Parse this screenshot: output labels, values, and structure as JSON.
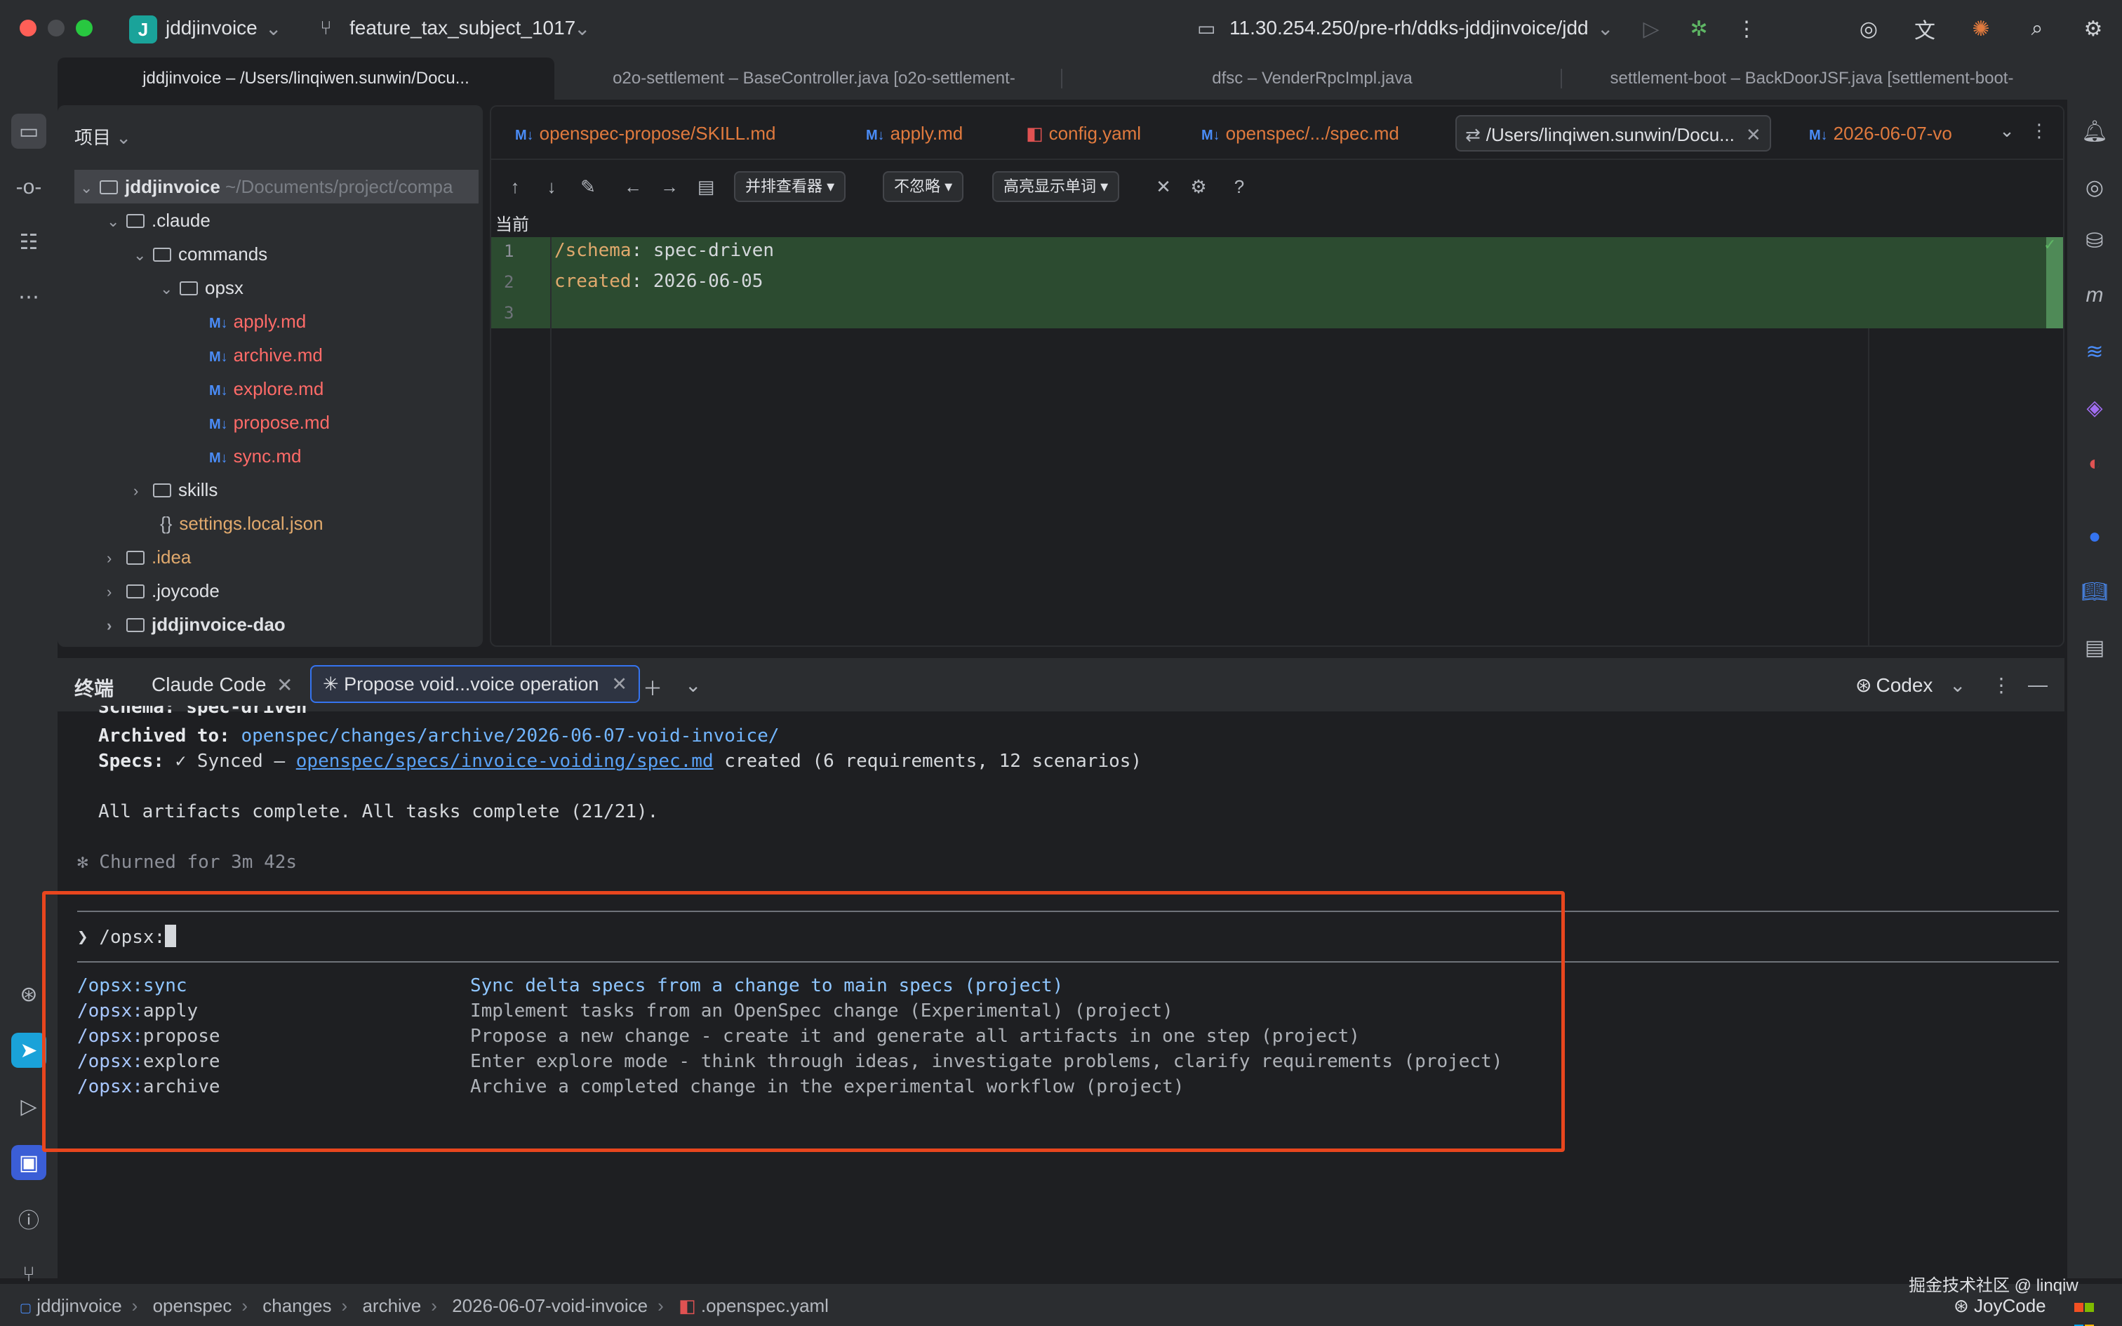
{
  "titlebar": {
    "project_name": "jddjinvoice",
    "project_initial": "J",
    "branch": "feature_tax_subject_1017",
    "remote": "11.30.254.250/pre-rh/ddks-jddjinvoice/jdd"
  },
  "window_tabs": [
    {
      "label": "jddjinvoice – /Users/linqiwen.sunwin/Docu...",
      "active": true
    },
    {
      "label": "o2o-settlement – BaseController.java [o2o-settlement-"
    },
    {
      "label": "dfsc – VenderRpcImpl.java"
    },
    {
      "label": "settlement-boot – BackDoorJSF.java [settlement-boot-"
    }
  ],
  "project_panel": {
    "title": "项目",
    "root_name": "jddjinvoice",
    "root_path": "~/Documents/project/compa",
    "tree": [
      {
        "label": ".claude"
      },
      {
        "label": "commands"
      },
      {
        "label": "opsx"
      },
      {
        "label": "apply.md"
      },
      {
        "label": "archive.md"
      },
      {
        "label": "explore.md"
      },
      {
        "label": "propose.md"
      },
      {
        "label": "sync.md"
      },
      {
        "label": "skills"
      },
      {
        "label": "settings.local.json"
      },
      {
        "label": ".idea"
      },
      {
        "label": ".joycode"
      },
      {
        "label": "jddjinvoice-dao"
      }
    ]
  },
  "editor": {
    "tabs": [
      {
        "label": "openspec-propose/SKILL.md"
      },
      {
        "label": "apply.md"
      },
      {
        "label": "config.yaml"
      },
      {
        "label": "openspec/.../spec.md"
      },
      {
        "label": "/Users/linqiwen.sunwin/Docu...",
        "active": true
      },
      {
        "label": "2026-06-07-vo"
      }
    ],
    "toolbar": {
      "viewer_mode": "并排查看器",
      "ignore_mode": "不忽略",
      "highlight_mode": "高亮显示单词"
    },
    "diff_label": "当前",
    "lines": [
      {
        "num": "1",
        "key": "/schema",
        "value": " spec-driven"
      },
      {
        "num": "2",
        "key": "created",
        "value": " 2026-06-05"
      },
      {
        "num": "3",
        "key": "",
        "value": ""
      }
    ]
  },
  "terminal": {
    "title": "终端",
    "tabs": [
      {
        "label": "Claude Code"
      },
      {
        "label": "✳ Propose void...voice operation",
        "active": true
      }
    ],
    "agent": "Codex",
    "partial_line": "Schema: spec-driven",
    "archived_label": "Archived to:",
    "archived_path": "openspec/changes/archive/2026-06-07-void-invoice/",
    "specs_label": "Specs:",
    "specs_status": " ✓ Synced — ",
    "specs_link": "openspec/specs/invoice-voiding/spec.md",
    "specs_result": " created (6 requirements, 12 scenarios)",
    "complete_line": "All artifacts complete. All tasks complete (21/21).",
    "churned": "✻ Churned for 3m 42s",
    "prompt_symbol": "❯",
    "prompt_input": "/opsx:",
    "commands": [
      {
        "prefix": "/opsx:",
        "name": "sync",
        "desc": "Sync delta specs from a change to main specs (project)",
        "selected": true
      },
      {
        "prefix": "/opsx:",
        "name": "apply",
        "desc": "Implement tasks from an OpenSpec change (Experimental) (project)"
      },
      {
        "prefix": "/opsx:",
        "name": "propose",
        "desc": "Propose a new change - create it and generate all artifacts in one step (project)"
      },
      {
        "prefix": "/opsx:",
        "name": "explore",
        "desc": "Enter explore mode - think through ideas, investigate problems, clarify requirements (project)"
      },
      {
        "prefix": "/opsx:",
        "name": "archive",
        "desc": "Archive a completed change in the experimental workflow (project)"
      }
    ]
  },
  "statusbar": {
    "breadcrumb": [
      "jddjinvoice",
      "openspec",
      "changes",
      "archive",
      "2026-06-07-void-invoice",
      ".openspec.yaml"
    ],
    "watermark": "掘金技术社区 @ linqiw",
    "brand": "JoyCode"
  },
  "colors": {
    "accent": "#3574f0",
    "highlight_box": "#e8461e",
    "diff_added_bg": "#2c4b30",
    "project_badge": "#1aa39a"
  }
}
